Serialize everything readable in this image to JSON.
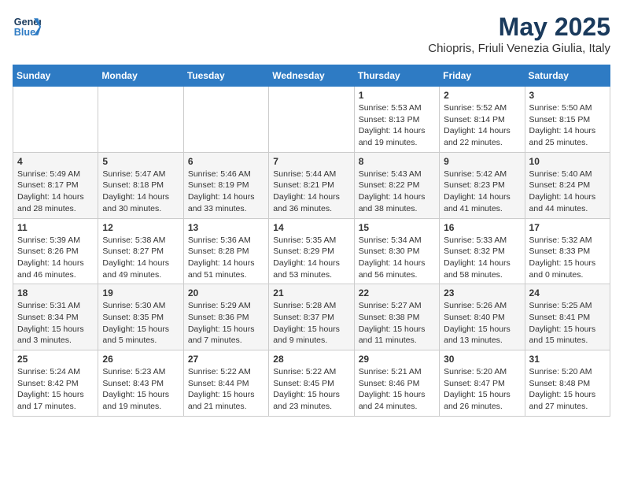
{
  "logo": {
    "line1": "General",
    "line2": "Blue"
  },
  "title": {
    "month_year": "May 2025",
    "location": "Chiopris, Friuli Venezia Giulia, Italy"
  },
  "days_of_week": [
    "Sunday",
    "Monday",
    "Tuesday",
    "Wednesday",
    "Thursday",
    "Friday",
    "Saturday"
  ],
  "weeks": [
    [
      {
        "day": "",
        "content": ""
      },
      {
        "day": "",
        "content": ""
      },
      {
        "day": "",
        "content": ""
      },
      {
        "day": "",
        "content": ""
      },
      {
        "day": "1",
        "content": "Sunrise: 5:53 AM\nSunset: 8:13 PM\nDaylight: 14 hours\nand 19 minutes."
      },
      {
        "day": "2",
        "content": "Sunrise: 5:52 AM\nSunset: 8:14 PM\nDaylight: 14 hours\nand 22 minutes."
      },
      {
        "day": "3",
        "content": "Sunrise: 5:50 AM\nSunset: 8:15 PM\nDaylight: 14 hours\nand 25 minutes."
      }
    ],
    [
      {
        "day": "4",
        "content": "Sunrise: 5:49 AM\nSunset: 8:17 PM\nDaylight: 14 hours\nand 28 minutes."
      },
      {
        "day": "5",
        "content": "Sunrise: 5:47 AM\nSunset: 8:18 PM\nDaylight: 14 hours\nand 30 minutes."
      },
      {
        "day": "6",
        "content": "Sunrise: 5:46 AM\nSunset: 8:19 PM\nDaylight: 14 hours\nand 33 minutes."
      },
      {
        "day": "7",
        "content": "Sunrise: 5:44 AM\nSunset: 8:21 PM\nDaylight: 14 hours\nand 36 minutes."
      },
      {
        "day": "8",
        "content": "Sunrise: 5:43 AM\nSunset: 8:22 PM\nDaylight: 14 hours\nand 38 minutes."
      },
      {
        "day": "9",
        "content": "Sunrise: 5:42 AM\nSunset: 8:23 PM\nDaylight: 14 hours\nand 41 minutes."
      },
      {
        "day": "10",
        "content": "Sunrise: 5:40 AM\nSunset: 8:24 PM\nDaylight: 14 hours\nand 44 minutes."
      }
    ],
    [
      {
        "day": "11",
        "content": "Sunrise: 5:39 AM\nSunset: 8:26 PM\nDaylight: 14 hours\nand 46 minutes."
      },
      {
        "day": "12",
        "content": "Sunrise: 5:38 AM\nSunset: 8:27 PM\nDaylight: 14 hours\nand 49 minutes."
      },
      {
        "day": "13",
        "content": "Sunrise: 5:36 AM\nSunset: 8:28 PM\nDaylight: 14 hours\nand 51 minutes."
      },
      {
        "day": "14",
        "content": "Sunrise: 5:35 AM\nSunset: 8:29 PM\nDaylight: 14 hours\nand 53 minutes."
      },
      {
        "day": "15",
        "content": "Sunrise: 5:34 AM\nSunset: 8:30 PM\nDaylight: 14 hours\nand 56 minutes."
      },
      {
        "day": "16",
        "content": "Sunrise: 5:33 AM\nSunset: 8:32 PM\nDaylight: 14 hours\nand 58 minutes."
      },
      {
        "day": "17",
        "content": "Sunrise: 5:32 AM\nSunset: 8:33 PM\nDaylight: 15 hours\nand 0 minutes."
      }
    ],
    [
      {
        "day": "18",
        "content": "Sunrise: 5:31 AM\nSunset: 8:34 PM\nDaylight: 15 hours\nand 3 minutes."
      },
      {
        "day": "19",
        "content": "Sunrise: 5:30 AM\nSunset: 8:35 PM\nDaylight: 15 hours\nand 5 minutes."
      },
      {
        "day": "20",
        "content": "Sunrise: 5:29 AM\nSunset: 8:36 PM\nDaylight: 15 hours\nand 7 minutes."
      },
      {
        "day": "21",
        "content": "Sunrise: 5:28 AM\nSunset: 8:37 PM\nDaylight: 15 hours\nand 9 minutes."
      },
      {
        "day": "22",
        "content": "Sunrise: 5:27 AM\nSunset: 8:38 PM\nDaylight: 15 hours\nand 11 minutes."
      },
      {
        "day": "23",
        "content": "Sunrise: 5:26 AM\nSunset: 8:40 PM\nDaylight: 15 hours\nand 13 minutes."
      },
      {
        "day": "24",
        "content": "Sunrise: 5:25 AM\nSunset: 8:41 PM\nDaylight: 15 hours\nand 15 minutes."
      }
    ],
    [
      {
        "day": "25",
        "content": "Sunrise: 5:24 AM\nSunset: 8:42 PM\nDaylight: 15 hours\nand 17 minutes."
      },
      {
        "day": "26",
        "content": "Sunrise: 5:23 AM\nSunset: 8:43 PM\nDaylight: 15 hours\nand 19 minutes."
      },
      {
        "day": "27",
        "content": "Sunrise: 5:22 AM\nSunset: 8:44 PM\nDaylight: 15 hours\nand 21 minutes."
      },
      {
        "day": "28",
        "content": "Sunrise: 5:22 AM\nSunset: 8:45 PM\nDaylight: 15 hours\nand 23 minutes."
      },
      {
        "day": "29",
        "content": "Sunrise: 5:21 AM\nSunset: 8:46 PM\nDaylight: 15 hours\nand 24 minutes."
      },
      {
        "day": "30",
        "content": "Sunrise: 5:20 AM\nSunset: 8:47 PM\nDaylight: 15 hours\nand 26 minutes."
      },
      {
        "day": "31",
        "content": "Sunrise: 5:20 AM\nSunset: 8:48 PM\nDaylight: 15 hours\nand 27 minutes."
      }
    ]
  ]
}
